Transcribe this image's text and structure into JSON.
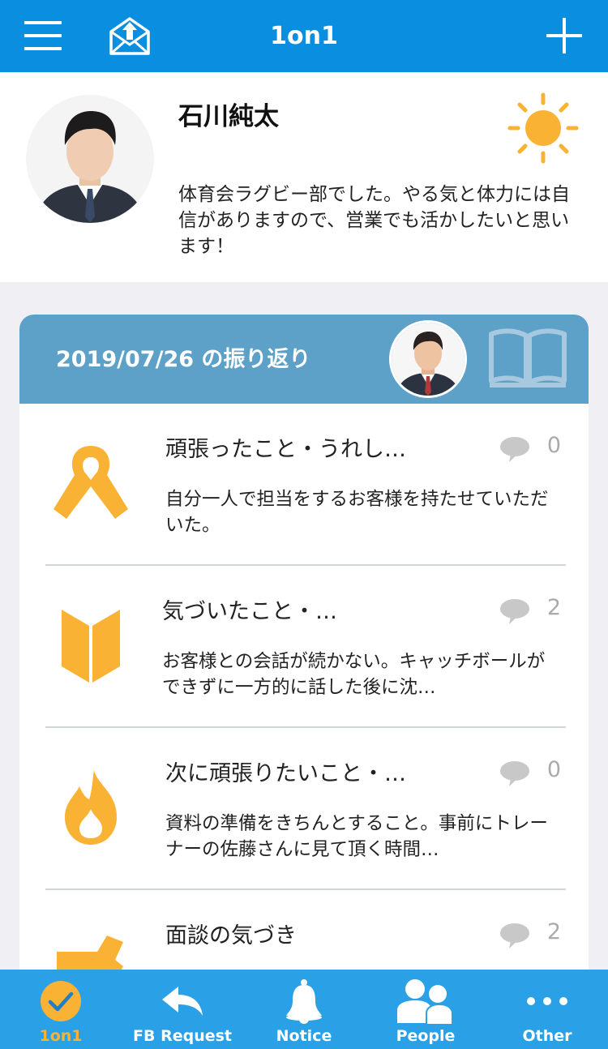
{
  "header": {
    "title": "1on1"
  },
  "profile": {
    "name": "石川純太",
    "bio": "体育会ラグビー部でした。やる気と体力には自信がありますので、営業でも活かしたいと思います！"
  },
  "review": {
    "title": "2019/07/26 の振り返り",
    "items": [
      {
        "icon": "ribbon-icon",
        "title": "頑張ったこと・うれし…",
        "text": "自分一人で担当をするお客様を持たせていただいた。",
        "comments": "0"
      },
      {
        "icon": "beginner-mark-icon",
        "title": "気づいたこと・…",
        "text": "お客様との会話が続かない。キャッチボールができずに一方的に話した後に沈…",
        "comments": "2"
      },
      {
        "icon": "flame-icon",
        "title": "次に頑張りたいこと・…",
        "text": "資料の準備をきちんとすること。事前にトレーナーの佐藤さんに見て頂く時間…",
        "comments": "0"
      },
      {
        "icon": "hammer-icon",
        "title": "面談の気づき",
        "text": "",
        "comments": "2"
      }
    ]
  },
  "tabs": [
    {
      "label": "1on1",
      "icon": "check-circle-icon",
      "active": true
    },
    {
      "label": "FB Request",
      "icon": "reply-arrow-icon"
    },
    {
      "label": "Notice",
      "icon": "bell-icon"
    },
    {
      "label": "People",
      "icon": "people-icon"
    },
    {
      "label": "Other",
      "icon": "ellipsis-icon"
    }
  ],
  "colors": {
    "navbar": "#0a8fe0",
    "card_header": "#5da0c8",
    "accent": "#f9b233",
    "tabbar": "#2aa0e6"
  }
}
